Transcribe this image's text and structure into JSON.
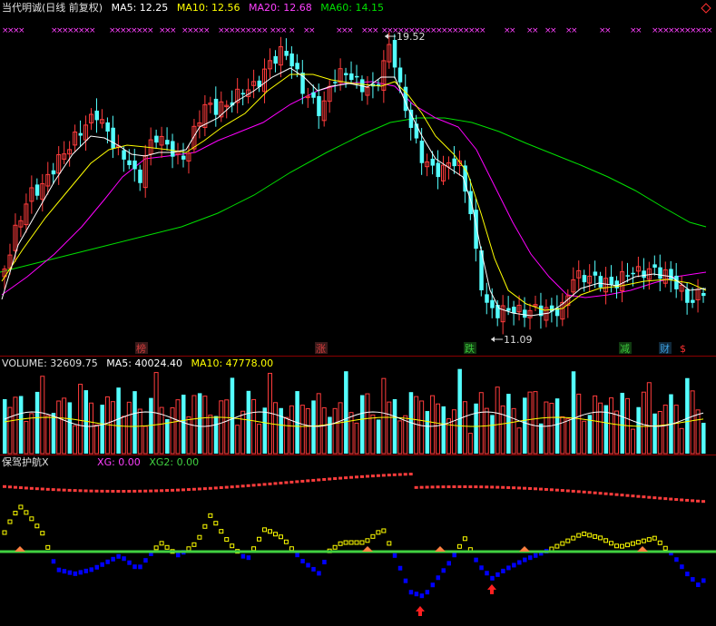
{
  "price_legend": {
    "title": "当代明诚(日线 前复权)",
    "ma5": "MA5: 12.25",
    "ma10": "MA10: 12.56",
    "ma20": "MA20: 12.68",
    "ma60": "MA60: 14.15"
  },
  "volume_legend": {
    "volume": "VOLUME: 32609.75",
    "ma5": "MA5: 40024.40",
    "ma10": "MA10: 47778.00"
  },
  "indicator_legend": {
    "name": "保驾护航X",
    "xg": "XG: 0.00",
    "xg2": "XG2: 0.00"
  },
  "annotations": {
    "high": "19.52",
    "low": "11.09"
  },
  "event_markers": [
    {
      "label": "榜",
      "color": "#d23c3c",
      "bg": "#3a1a1a"
    },
    {
      "label": "涨",
      "color": "#d23c3c",
      "bg": "#3a1a1a"
    },
    {
      "label": "跌",
      "color": "#3cc83c",
      "bg": "#103a10"
    },
    {
      "label": "减",
      "color": "#3cc83c",
      "bg": "#103a10"
    },
    {
      "label": "财",
      "color": "#3ca0e0",
      "bg": "#10283a"
    },
    {
      "label": "$",
      "color": "#ff3030",
      "bg": "#000000"
    }
  ],
  "colors": {
    "background": "#000000",
    "up": "#ff3c3c",
    "down": "#54ffff",
    "ma5": "#ffffff",
    "ma10": "#ffff00",
    "ma20": "#ff00ff",
    "ma60": "#00e000",
    "indicator_line": "#40d040",
    "indicator_blue": "#0000ff",
    "indicator_yellow": "#ffff00",
    "title": "#e0e0e0",
    "volume_label": "#e0e0e0"
  },
  "icons": [
    "diamond-icon",
    "cross-mark-icon",
    "red-arrow-up-icon"
  ]
}
